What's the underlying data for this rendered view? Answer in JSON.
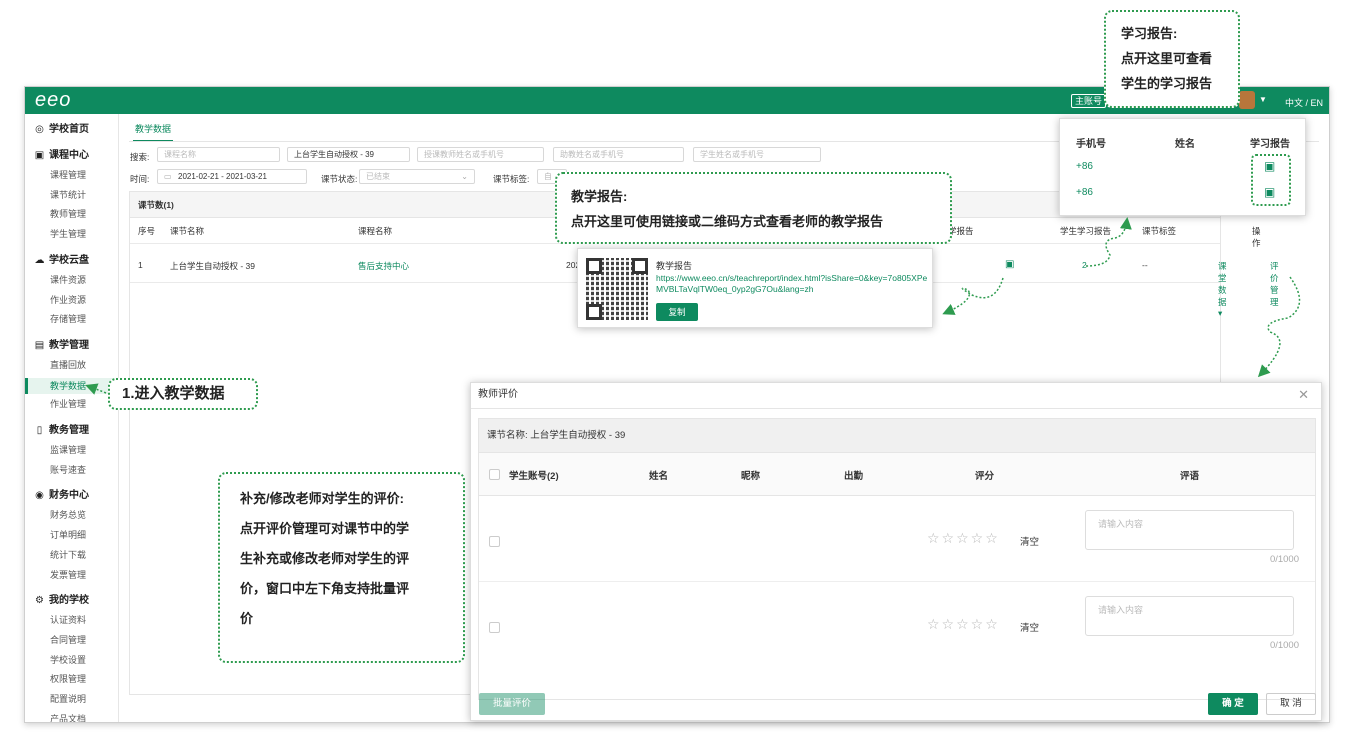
{
  "header": {
    "logo": "eeo",
    "account": "主账号",
    "lang": "中文 / EN"
  },
  "sidebar": {
    "items": [
      {
        "label": "学校首页",
        "type": "sec",
        "icon": "◎"
      },
      {
        "label": "课程中心",
        "type": "sec",
        "icon": "▣"
      },
      {
        "label": "课程管理",
        "type": "sub"
      },
      {
        "label": "课节统计",
        "type": "sub"
      },
      {
        "label": "教师管理",
        "type": "sub"
      },
      {
        "label": "学生管理",
        "type": "sub"
      },
      {
        "label": "学校云盘",
        "type": "sec",
        "icon": "☁"
      },
      {
        "label": "课件资源",
        "type": "sub"
      },
      {
        "label": "作业资源",
        "type": "sub"
      },
      {
        "label": "存储管理",
        "type": "sub"
      },
      {
        "label": "教学管理",
        "type": "sec",
        "icon": "▤"
      },
      {
        "label": "直播回放",
        "type": "sub"
      },
      {
        "label": "教学数据",
        "type": "active"
      },
      {
        "label": "作业管理",
        "type": "sub"
      },
      {
        "label": "教务管理",
        "type": "sec",
        "icon": "▯"
      },
      {
        "label": "监课管理",
        "type": "sub"
      },
      {
        "label": "账号速查",
        "type": "sub"
      },
      {
        "label": "财务中心",
        "type": "sec",
        "icon": "◉"
      },
      {
        "label": "财务总览",
        "type": "sub"
      },
      {
        "label": "订单明细",
        "type": "sub"
      },
      {
        "label": "统计下载",
        "type": "sub"
      },
      {
        "label": "发票管理",
        "type": "sub"
      },
      {
        "label": "我的学校",
        "type": "sec",
        "icon": "⚙"
      },
      {
        "label": "认证资料",
        "type": "sub"
      },
      {
        "label": "合同管理",
        "type": "sub"
      },
      {
        "label": "学校设置",
        "type": "sub"
      },
      {
        "label": "权限管理",
        "type": "sub"
      },
      {
        "label": "配置说明",
        "type": "sub"
      },
      {
        "label": "产品文档",
        "type": "sub"
      }
    ]
  },
  "main": {
    "tab": "教学数据",
    "filters": {
      "search_label": "搜索:",
      "lesson_name_placeholder": "课程名称",
      "lesson_value": "上台学生自动授权 - 39",
      "teacher_placeholder": "授课教师姓名或手机号",
      "assistant_placeholder": "助教姓名或手机号",
      "student_placeholder": "学生姓名或手机号",
      "time_label": "时间:",
      "date_range": "2021-02-21  - 2021-03-21",
      "status_label": "课节状态:",
      "status_value": "已结束",
      "tag_label": "课节标签:",
      "tag_value": "自"
    },
    "table": {
      "count_label": "课节数(1)",
      "headers": [
        "序号",
        "课节名称",
        "课程名称",
        "学报告",
        "学生学习报告",
        "课节标签",
        "操作"
      ],
      "row": {
        "index": "1",
        "lesson": "上台学生自动授权 - 39",
        "course": "售后支持中心",
        "date": "202",
        "study": "2",
        "tag": "--",
        "op_data": "课堂数据 ▾",
        "op_eval": "评价管理"
      }
    }
  },
  "report_popup": {
    "title": "教学报告",
    "url": "https://www.eeo.cn/s/teachreport/index.html?isShare=0&key=7o805XPeMVBLTaVqlTW0eq_0yp2gG7Ou&lang=zh",
    "copy": "复制"
  },
  "study_popup": {
    "headers": [
      "手机号",
      "姓名",
      "学习报告"
    ],
    "rows": [
      "+86",
      "+86"
    ]
  },
  "dialog": {
    "title": "教师评价",
    "lesson_label": "课节名称: 上台学生自动授权 - 39",
    "headers": [
      "学生账号(2)",
      "姓名",
      "昵称",
      "出勤",
      "评分",
      "评语"
    ],
    "clear": "清空",
    "comment_placeholder": "请输入内容",
    "counter": "0/1000",
    "batch": "批量评价",
    "confirm": "确 定",
    "cancel": "取 消"
  },
  "callouts": {
    "study": [
      "学习报告:",
      "点开这里可查看",
      "学生的学习报告"
    ],
    "teach": [
      "教学报告:",
      "点开这里可使用链接或二维码方式查看老师的教学报告"
    ],
    "enter": "1.进入教学数据",
    "eval": [
      "补充/修改老师对学生的评价:",
      "点开评价管理可对课节中的学",
      "生补充或修改老师对学生的评",
      "价，窗口中左下角支持批量评",
      "价"
    ]
  },
  "colors": {
    "brand": "#0e8a5f",
    "callout_border": "#2e9b4f"
  }
}
